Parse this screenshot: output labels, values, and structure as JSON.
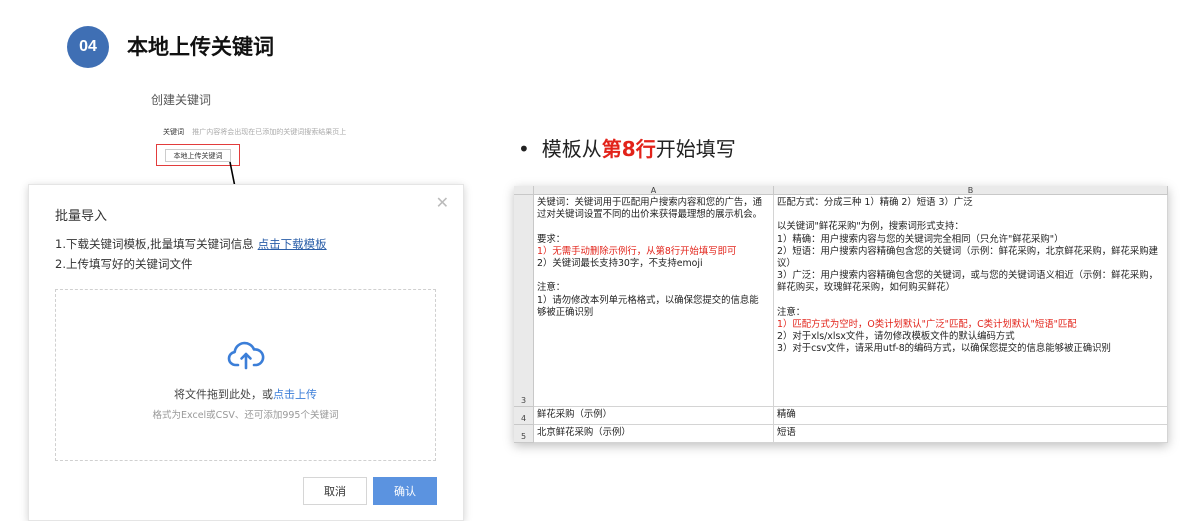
{
  "header": {
    "step_number": "04",
    "title": "本地上传关键词"
  },
  "create_form": {
    "title": "创建关键词",
    "keyword_label": "关键词",
    "keyword_hint": "推广内容将会出现在已添加的关键词搜索结果页上",
    "upload_button": "本地上传关键词"
  },
  "dialog": {
    "title": "批量导入",
    "close_icon": "close-icon",
    "step1_text": "1.下载关键词模板,批量填写关键词信息",
    "step1_link": "点击下载模板",
    "step2_text": "2.上传填写好的关键词文件",
    "upload_icon": "cloud-upload-icon",
    "drop_text": "将文件拖到此处，或",
    "drop_link": "点击上传",
    "drop_hint": "格式为Excel或CSV、还可添加995个关键词",
    "cancel_label": "取消",
    "confirm_label": "确认",
    "accent_color": "#5b93e0"
  },
  "note": {
    "bullet": "•",
    "prefix": "模板从",
    "emphasis": "第8行",
    "suffix": "开始填写",
    "emphasis_color": "#e2231a"
  },
  "spreadsheet": {
    "columns": [
      "A",
      "B"
    ],
    "rows": [
      "3",
      "4",
      "5"
    ],
    "cell_a3": [
      {
        "text": "关键词：关键词用于匹配用户搜索内容和您的广告，通",
        "color": ""
      },
      {
        "text": "过对关键词设置不同的出价来获得最理想的展示机会。",
        "color": ""
      },
      {
        "text": "",
        "color": ""
      },
      {
        "text": "要求：",
        "color": ""
      },
      {
        "text": "1）无需手动删除示例行，从第8行开始填写即可",
        "color": "red"
      },
      {
        "text": "2）关键词最长支持30字，不支持emoji",
        "color": ""
      },
      {
        "text": "",
        "color": ""
      },
      {
        "text": "注意：",
        "color": ""
      },
      {
        "text": "1）请勿修改本列单元格格式，以确保您提交的信息能",
        "color": ""
      },
      {
        "text": "够被正确识别",
        "color": ""
      }
    ],
    "cell_b3": [
      {
        "text": "匹配方式：分成三种 1）精确 2）短语 3）广泛",
        "color": ""
      },
      {
        "text": "",
        "color": ""
      },
      {
        "text": "以关键词\"鲜花采购\"为例，搜索词形式支持：",
        "color": ""
      },
      {
        "text": "1）精确：用户搜索内容与您的关键词完全相同（只允许\"鲜花采购\"）",
        "color": ""
      },
      {
        "text": "2）短语：用户搜索内容精确包含您的关键词（示例：鲜花采购，北京鲜花采购，鲜花采购建",
        "color": ""
      },
      {
        "text": "议）",
        "color": ""
      },
      {
        "text": "3）广泛：用户搜索内容精确包含您的关键词，或与您的关键词语义相近（示例：鲜花采购，",
        "color": ""
      },
      {
        "text": "鲜花购买，玫瑰鲜花采购，如何购买鲜花）",
        "color": ""
      },
      {
        "text": "",
        "color": ""
      },
      {
        "text": "注意：",
        "color": ""
      },
      {
        "text": "1）匹配方式为空时，O类计划默认\"广泛\"匹配，C类计划默认\"短语\"匹配",
        "color": "red"
      },
      {
        "text": "2）对于xls/xlsx文件，请勿修改模板文件的默认编码方式",
        "color": ""
      },
      {
        "text": "3）对于csv文件，请采用utf-8的编码方式，以确保您提交的信息能够被正确识别",
        "color": ""
      }
    ],
    "cell_a4": "鲜花采购（示例）",
    "cell_b4": "精确",
    "cell_a5": "北京鲜花采购（示例）",
    "cell_b5": "短语"
  }
}
